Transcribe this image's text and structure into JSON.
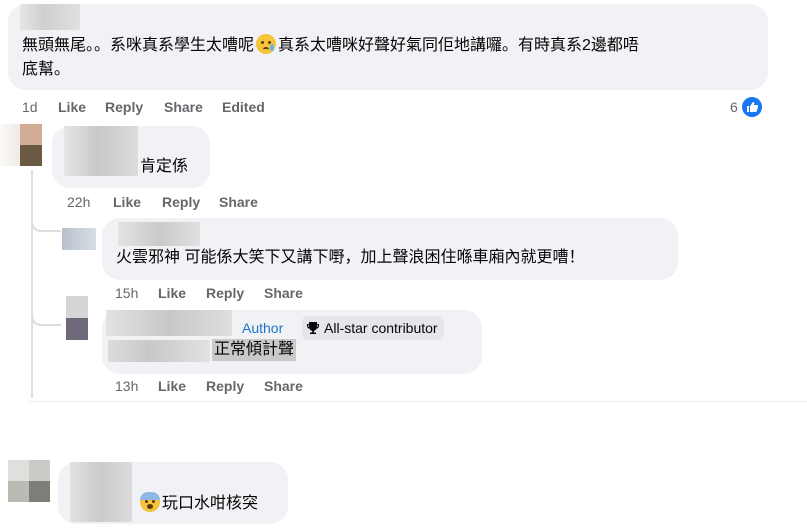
{
  "comments": [
    {
      "text_line1": "無頭無尾。。系咪真系學生太嘈呢",
      "text_line1b": "真系太嘈咪好聲好氣同佢地講囉。有時真系2邊都唔",
      "text_line2": "底幫。",
      "emoji": "disappointed-relieved-face",
      "actions": {
        "time": "1d",
        "like": "Like",
        "reply": "Reply",
        "share": "Share",
        "edited": "Edited"
      },
      "reaction_count": "6",
      "reaction": "like-reaction"
    },
    {
      "text": "肯定係",
      "actions": {
        "time": "22h",
        "like": "Like",
        "reply": "Reply",
        "share": "Share"
      }
    },
    {
      "text": "火雲邪神 可能係大笑下又講下嘢，加上聲浪困住喺車廂內就更嘈！",
      "actions": {
        "time": "15h",
        "like": "Like",
        "reply": "Reply",
        "share": "Share"
      }
    },
    {
      "author_badge": "Author",
      "contributor_badge": "All-star contributor",
      "contributor_icon": "trophy-icon",
      "text": "正常傾計聲",
      "actions": {
        "time": "13h",
        "like": "Like",
        "reply": "Reply",
        "share": "Share"
      }
    },
    {
      "text": "玩口水咁核突",
      "emoji": "face-with-open-mouth-cold-sweat"
    }
  ],
  "colors": {
    "bubble": "#f0f2f5",
    "action_text": "#65676b",
    "author": "#1d73c9",
    "like_blue": "#1877f2",
    "thread_line": "#dadde1"
  }
}
